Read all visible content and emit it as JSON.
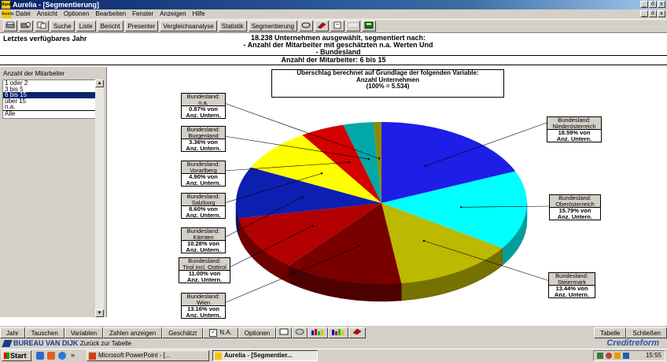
{
  "window": {
    "title": "Aurelia - [Segmentierung]",
    "app_icon_text": "Aurelia",
    "buttons": [
      "_",
      "ő",
      "x"
    ]
  },
  "menu": {
    "items": [
      "Datei",
      "Ansicht",
      "Optionen",
      "Bearbeiten",
      "Fenster",
      "Anzeigen",
      "Hilfe"
    ],
    "mdi_buttons": [
      "_",
      "ő",
      "x"
    ]
  },
  "toolbar": {
    "buttons": [
      "Suche",
      "Liste",
      "Bericht",
      "Presenter",
      "Vergleichsanalyse",
      "Statistik",
      "Segmentierung"
    ]
  },
  "header": {
    "left": "Letztes verfügbares Jahr",
    "center_line1": "18.238 Unternehmen ausgewählt, segmentiert nach:",
    "center_line2": "- Anzahl der Mitarbeiter mit geschätzten n.a. Werten Und",
    "center_line3": "- Bundesland",
    "subtitle": "Anzahl der Mitarbeiter: 6 bis 15"
  },
  "left_panel": {
    "title": "Anzahl der Mitarbeiter",
    "items": [
      "1 oder 2",
      "3 bis 5",
      "6 bis 15",
      "über 15",
      "n.a.",
      "Alle"
    ],
    "selected_index": 2
  },
  "chart_title": {
    "line1": "Überschlag berechnet auf Grundlage der folgenden Variable:",
    "line2": "Anzahl Unternehmen",
    "line3": "(100% = 5.534)"
  },
  "chart_data": {
    "type": "pie",
    "title": "Überschlag berechnet auf Grundlage der folgenden Variable: Anzahl Unternehmen (100% = 5.534)",
    "unit_label": "Anz. Untern.",
    "slices": [
      {
        "label": "Niederösterreich",
        "value": 18.59,
        "color": "#1e1ee6"
      },
      {
        "label": "Oberösterreich",
        "value": 15.79,
        "color": "#00ffff"
      },
      {
        "label": "Steiermark",
        "value": 13.44,
        "color": "#bdb800"
      },
      {
        "label": "Wien",
        "value": 13.16,
        "color": "#7a0000"
      },
      {
        "label": "Tirol incl. Osttirol",
        "value": 11.0,
        "color": "#b30000"
      },
      {
        "label": "Kärnten",
        "value": 10.28,
        "color": "#0d1fb0"
      },
      {
        "label": "Salzburg",
        "value": 8.6,
        "color": "#ffff00"
      },
      {
        "label": "Vorarlberg",
        "value": 4.9,
        "color": "#d40000"
      },
      {
        "label": "Burgenland",
        "value": 3.36,
        "color": "#00a8a8"
      },
      {
        "label": "n.a.",
        "value": 0.87,
        "color": "#8c8c00"
      },
      {
        "label": "unlabeled",
        "value": 0.01,
        "color": "#ff0000"
      }
    ]
  },
  "labels": [
    {
      "head": "Bundesland:",
      "name": "Niederösterreich",
      "pct": "18.59% von",
      "sub": "Anz. Untern."
    },
    {
      "head": "Bundesland:",
      "name": "Oberösterreich",
      "pct": "15.79% von",
      "sub": "Anz. Untern."
    },
    {
      "head": "Bundesland:",
      "name": "Steiermark",
      "pct": "13.44% von",
      "sub": "Anz. Untern."
    },
    {
      "head": "Bundesland:",
      "name": "Wien",
      "pct": "13.16% von",
      "sub": "Anz. Untern."
    },
    {
      "head": "Bundesland:",
      "name": "Tirol incl. Osttirol",
      "pct": "11.00% von",
      "sub": "Anz. Untern."
    },
    {
      "head": "Bundesland:",
      "name": "Kärnten",
      "pct": "10.28% von",
      "sub": "Anz. Untern."
    },
    {
      "head": "Bundesland:",
      "name": "Salzburg",
      "pct": "8.60% von",
      "sub": "Anz. Untern."
    },
    {
      "head": "Bundesland:",
      "name": "Vorarlberg",
      "pct": "4.90% von",
      "sub": "Anz. Untern."
    },
    {
      "head": "Bundesland:",
      "name": "Burgenland",
      "pct": "3.36% von",
      "sub": "Anz. Untern."
    },
    {
      "head": "Bundesland:",
      "name": "n.a.",
      "pct": "0.87% von",
      "sub": "Anz. Untern."
    }
  ],
  "bottom_bar": {
    "jahr": "Jahr",
    "tauschen": "Tauschen",
    "variablen": "Variablen",
    "zahlen": "Zahlen anzeigen",
    "geschaetzt": "Geschätzt",
    "na": "N.A.",
    "na_checked": true,
    "optionen": "Optionen",
    "tabelle": "Tabelle",
    "schliessen": "Schließen"
  },
  "status": {
    "brand": "BUREAU VAN DIJK",
    "back": "Zurück zur Tabelle",
    "creditreform": "Creditreform"
  },
  "taskbar": {
    "start": "Start",
    "ppt": "Microsoft PowerPoint - [...",
    "aurelia": "Aurelia - [Segmentier...",
    "clock": "15:55",
    "chevron": "»"
  }
}
